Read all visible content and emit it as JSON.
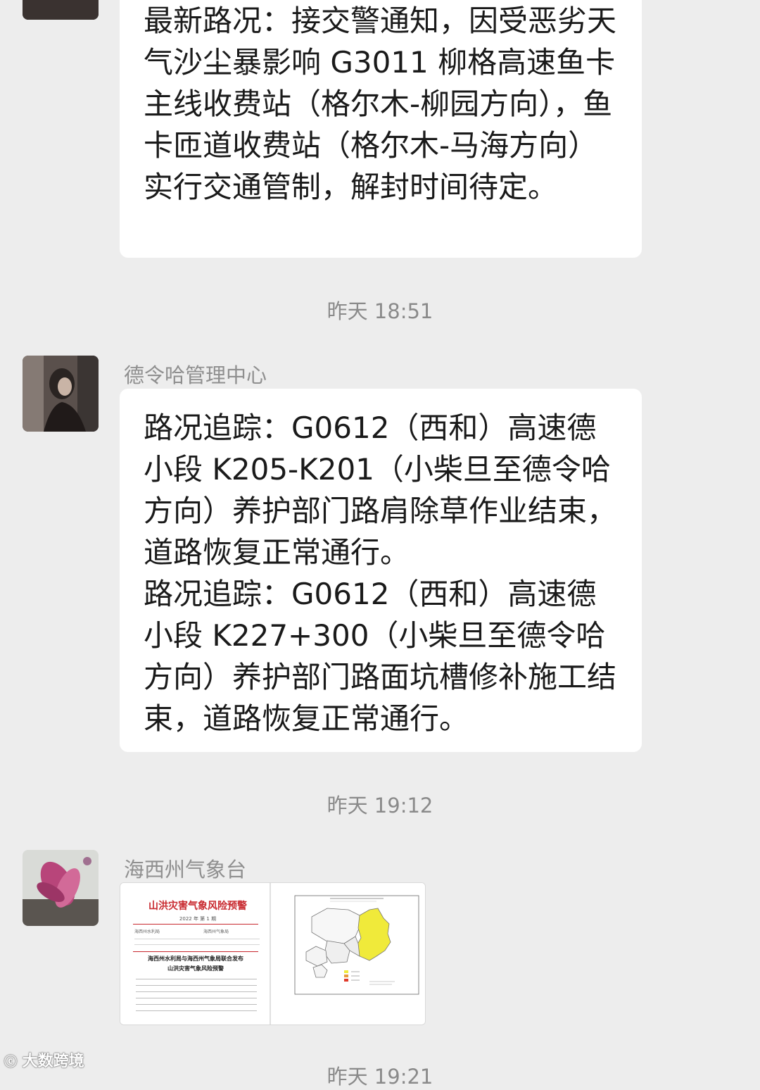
{
  "messages": [
    {
      "text": "最新路况：接交警通知，因受恶劣天气沙尘暴影响 G3011 柳格高速鱼卡主线收费站（格尔木-柳园方向），鱼卡匝道收费站（格尔木-马海方向）实行交通管制，解封时间待定。"
    },
    {
      "timestamp": "昨天 18:51",
      "sender": "德令哈管理中心",
      "paragraphs": [
        "路况追踪：G0612（西和）高速德小段 K205-K201（小柴旦至德令哈方向）养护部门路肩除草作业结束，道路恢复正常通行。",
        "路况追踪：G0612（西和）高速德小段 K227+300（小柴旦至德令哈方向）养护部门路面坑槽修补施工结束，道路恢复正常通行。"
      ]
    },
    {
      "timestamp": "昨天 19:12",
      "sender": "海西州气象台",
      "document": {
        "title": "山洪灾害气象风险预警",
        "issue": "2022 年 第 1 期",
        "issuer_left": "海西州水利局",
        "issuer_right": "海西州气象局",
        "heading": "海西州水利局与海西州气象局联合发布",
        "subheading": "山洪灾害气象风险预警"
      }
    },
    {
      "timestamp": "昨天 19:21"
    }
  ],
  "watermark": "大数跨境",
  "colors": {
    "background": "#ededed",
    "bubble": "#ffffff",
    "timestamp_text": "#8a8a8a",
    "sender_text": "#8f8f8f",
    "doc_title_red": "#c8282e",
    "map_warning_yellow": "#f0ea3a"
  }
}
